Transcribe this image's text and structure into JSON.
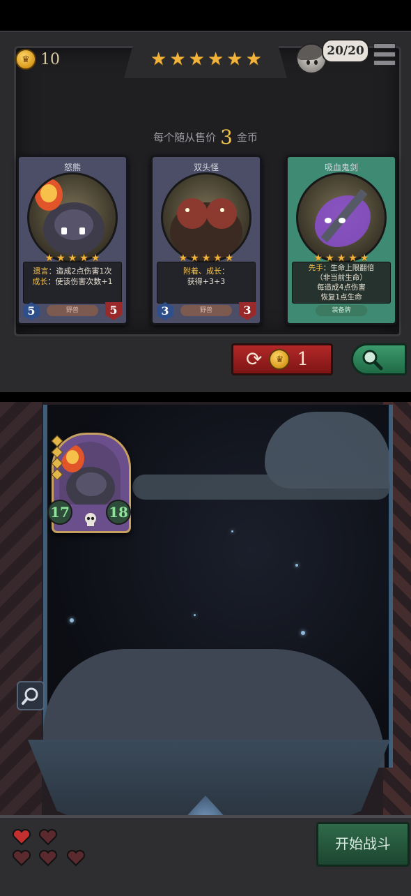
{
  "header": {
    "gold": "10",
    "star_count": 6,
    "player_hp": "20/20"
  },
  "shop": {
    "price_prefix": "每个随从售价",
    "price_value": "3",
    "price_suffix": "金币",
    "cards": [
      {
        "name": "怒熊",
        "stars": 5,
        "desc_line1_kw": "遗言",
        "desc_line1": "：造成2点伤害1次",
        "desc_line2_kw": "成长",
        "desc_line2": "：使该伤害次数+1",
        "tag": "野兽",
        "attack": "5",
        "health": "5"
      },
      {
        "name": "双头怪",
        "stars": 5,
        "desc_line1_kw": "附着、成长",
        "desc_line1": "：",
        "desc_line2_kw": "",
        "desc_line2": "获得+3+3",
        "tag": "野兽",
        "attack": "3",
        "health": "3"
      },
      {
        "name": "吸血鬼剑",
        "stars": 5,
        "desc_line1_kw": "先手",
        "desc_line1": "：生命上限翻倍",
        "desc_line2_kw": "",
        "desc_line2": "（非当前生命）",
        "desc_line3": "每造成4点伤害",
        "desc_line4": "恢复1点生命",
        "tag": "装备牌"
      }
    ],
    "refresh_cost": "1"
  },
  "board": {
    "minion": {
      "attack": "17",
      "health": "18"
    }
  },
  "footer": {
    "lives_total": 5,
    "start_label": "开始战斗"
  },
  "colors": {
    "gold": "#f2b33c",
    "refresh_red": "#b32828",
    "search_green": "#3c9a6c",
    "start_green": "#2f6a4a"
  }
}
